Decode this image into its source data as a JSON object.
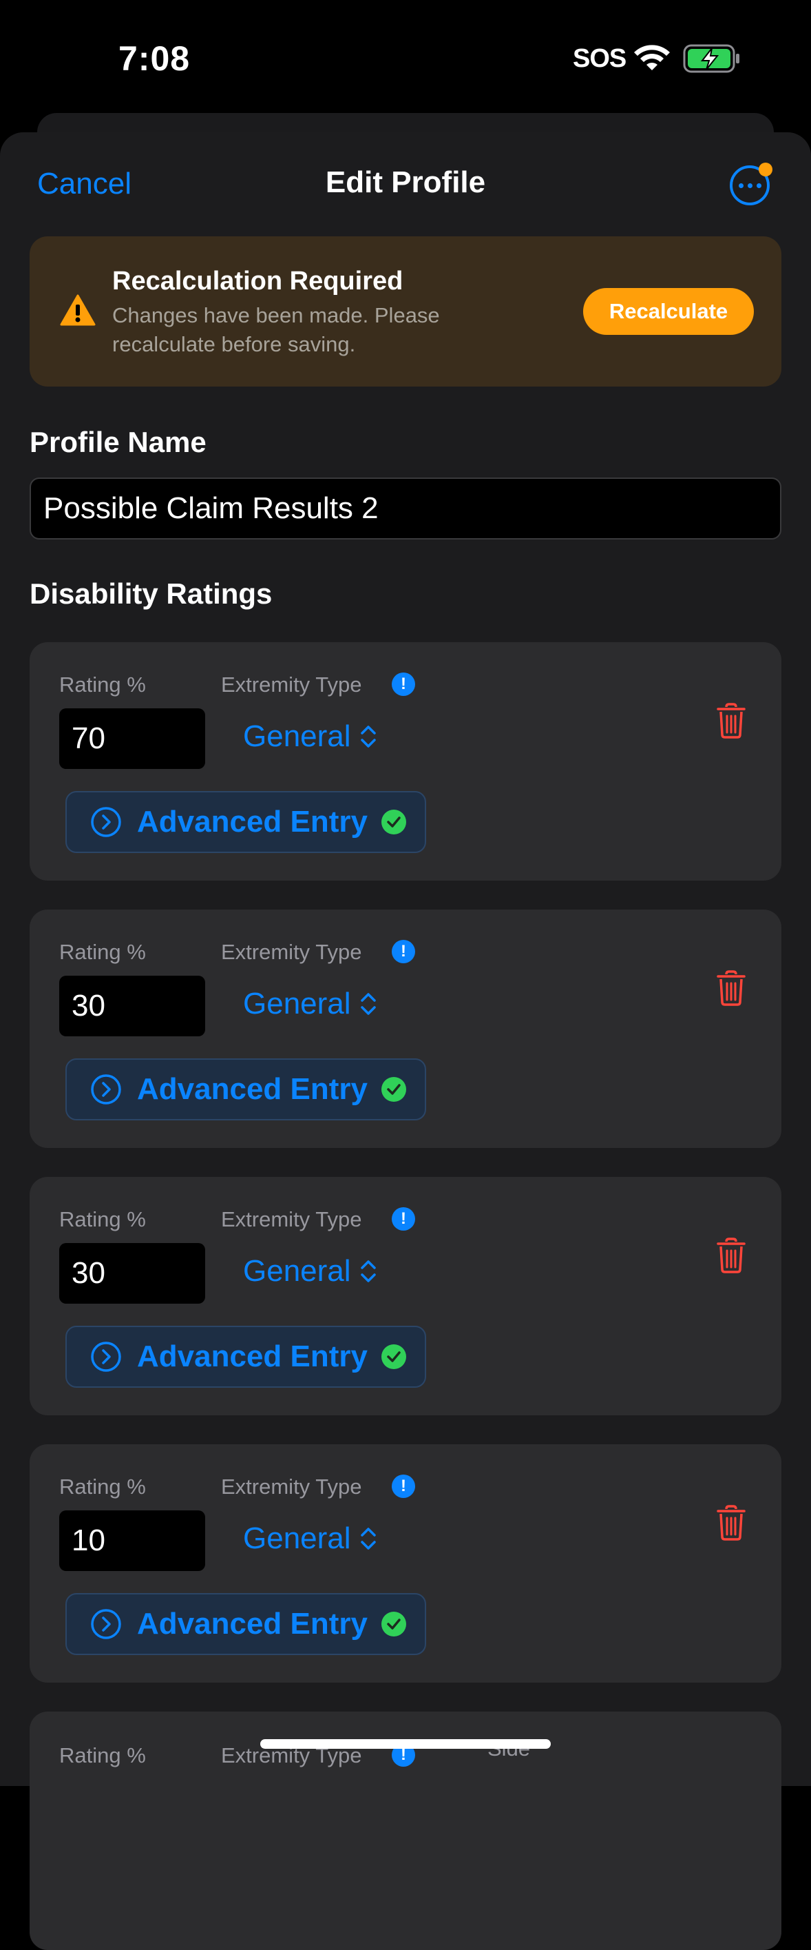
{
  "status": {
    "time": "7:08",
    "sos": "SOS"
  },
  "nav": {
    "cancel": "Cancel",
    "title": "Edit Profile"
  },
  "alert": {
    "title": "Recalculation Required",
    "message": "Changes have been made. Please recalculate before saving.",
    "button": "Recalculate"
  },
  "profile": {
    "section_label": "Profile Name",
    "name": "Possible Claim Results 2"
  },
  "ratings": {
    "section_label": "Disability Ratings",
    "rating_label": "Rating %",
    "extremity_label": "Extremity Type",
    "advanced_label": "Advanced Entry",
    "side_label": "Side",
    "items": [
      {
        "rating": "70",
        "extremity": "General"
      },
      {
        "rating": "30",
        "extremity": "General"
      },
      {
        "rating": "30",
        "extremity": "General"
      },
      {
        "rating": "10",
        "extremity": "General"
      }
    ]
  },
  "colors": {
    "accent": "#0a84ff",
    "warning": "#ff9f0a",
    "destructive": "#ff453a",
    "success": "#30d158",
    "card": "#2c2c2e",
    "sheet": "#1c1c1e"
  }
}
